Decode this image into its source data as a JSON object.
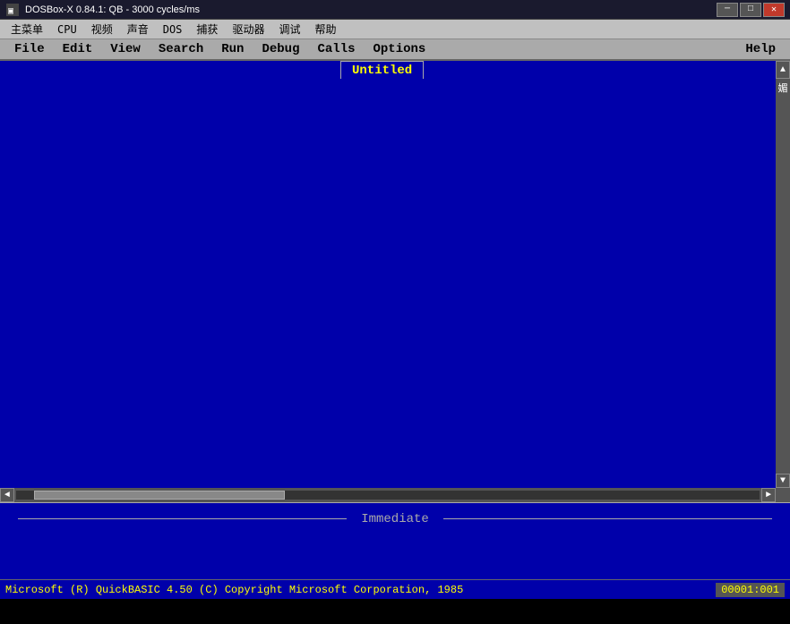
{
  "titlebar": {
    "icon": "▣",
    "text": "DOSBox-X 0.84.1: QB - 3000 cycles/ms",
    "minimize_label": "─",
    "restore_label": "□",
    "close_label": "✕"
  },
  "dos_menubar": {
    "items": [
      {
        "label": "主菜单"
      },
      {
        "label": "CPU"
      },
      {
        "label": "视频"
      },
      {
        "label": "声音"
      },
      {
        "label": "DOS"
      },
      {
        "label": "捕获"
      },
      {
        "label": "驱动器"
      },
      {
        "label": "调试"
      },
      {
        "label": "帮助"
      }
    ]
  },
  "qb_menubar": {
    "items": [
      {
        "label": "File"
      },
      {
        "label": "Edit"
      },
      {
        "label": "View"
      },
      {
        "label": "Search"
      },
      {
        "label": "Run"
      },
      {
        "label": "Debug"
      },
      {
        "label": "Calls"
      },
      {
        "label": "Options"
      }
    ],
    "help_label": "Help"
  },
  "editor": {
    "tab_title": "Untitled",
    "scroll_up": "▲",
    "scroll_down": "▼",
    "scroll_left": "◄",
    "scroll_right": "►",
    "right_chars": "媚"
  },
  "immediate": {
    "label": "Immediate"
  },
  "statusbar": {
    "text": "Microsoft (R) QuickBASIC 4.50 (C) Copyright Microsoft Corporation, 1985",
    "right": "00001:001"
  }
}
